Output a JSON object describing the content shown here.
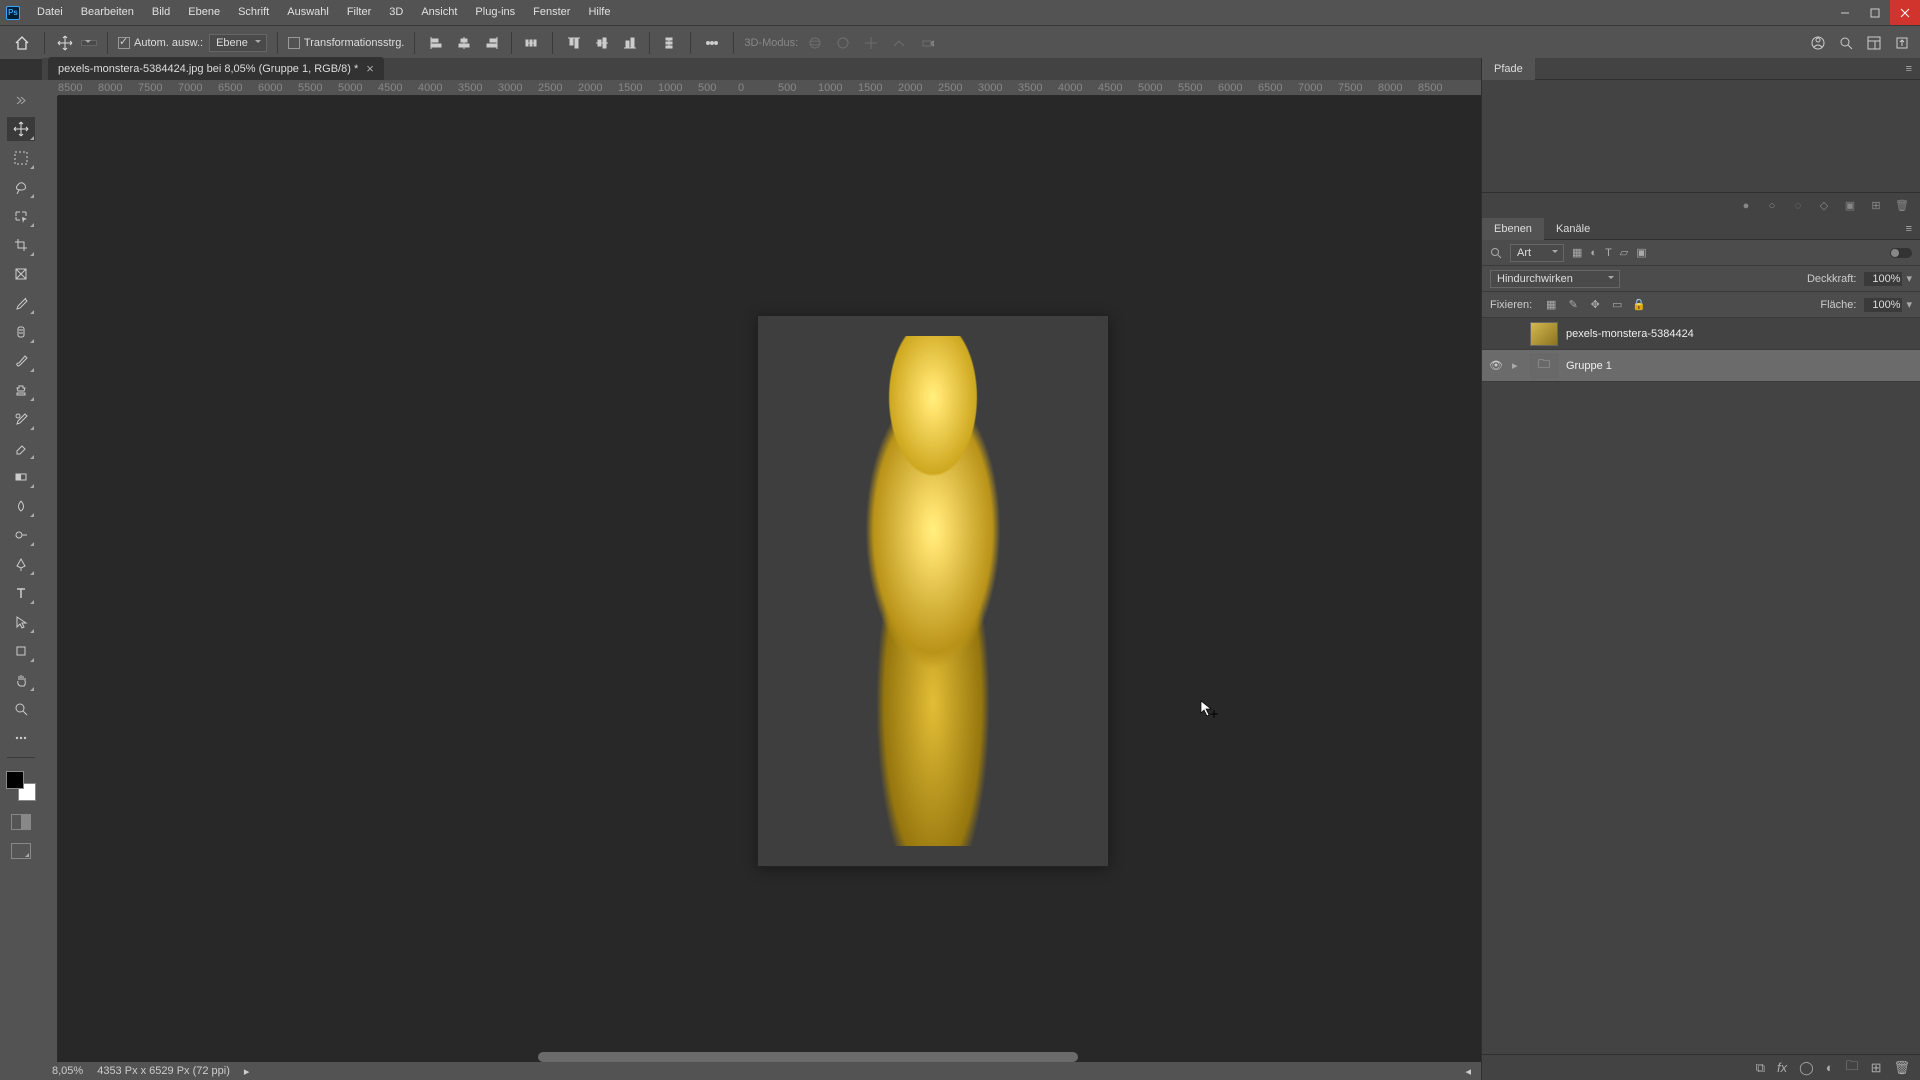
{
  "menu": {
    "items": [
      "Datei",
      "Bearbeiten",
      "Bild",
      "Ebene",
      "Schrift",
      "Auswahl",
      "Filter",
      "3D",
      "Ansicht",
      "Plug-ins",
      "Fenster",
      "Hilfe"
    ]
  },
  "optionsbar": {
    "auto_select_label": "Autom. ausw.:",
    "target_dropdown": "Ebene",
    "transform_label": "Transformationsstrg.",
    "mode_3d_label": "3D-Modus:"
  },
  "document": {
    "tab_title": "pexels-monstera-5384424.jpg bei 8,05% (Gruppe 1, RGB/8) *"
  },
  "ruler_ticks": [
    "8500",
    "8000",
    "7500",
    "7000",
    "6500",
    "6000",
    "5500",
    "5000",
    "4500",
    "4000",
    "3500",
    "3000",
    "2500",
    "2000",
    "1500",
    "1000",
    "500",
    "0",
    "500",
    "1000",
    "1500",
    "2000",
    "2500",
    "3000",
    "3500",
    "4000",
    "4500",
    "5000",
    "5500",
    "6000",
    "6500",
    "7000",
    "7500",
    "8000",
    "8500"
  ],
  "status": {
    "zoom": "8,05%",
    "doc_info": "4353 Px x 6529 Px (72 ppi)"
  },
  "paths_panel": {
    "tab": "Pfade"
  },
  "layers_panel": {
    "tabs": [
      "Ebenen",
      "Kanäle"
    ],
    "filter_label": "Art",
    "blend_mode": "Hindurchwirken",
    "opacity_label": "Deckkraft:",
    "opacity_value": "100%",
    "lock_label": "Fixieren:",
    "fill_label": "Fläche:",
    "fill_value": "100%",
    "layers": [
      {
        "visible": false,
        "type": "smart",
        "name": "pexels-monstera-5384424"
      },
      {
        "visible": true,
        "type": "group",
        "name": "Gruppe 1",
        "selected": true
      }
    ]
  },
  "tools": [
    "move",
    "artboard",
    "lasso",
    "quick-select",
    "crop",
    "frame",
    "eyedropper",
    "brush",
    "clone",
    "eraser",
    "gradient",
    "smudge",
    "dodge",
    "pen",
    "type",
    "path-select",
    "shape",
    "hand"
  ]
}
